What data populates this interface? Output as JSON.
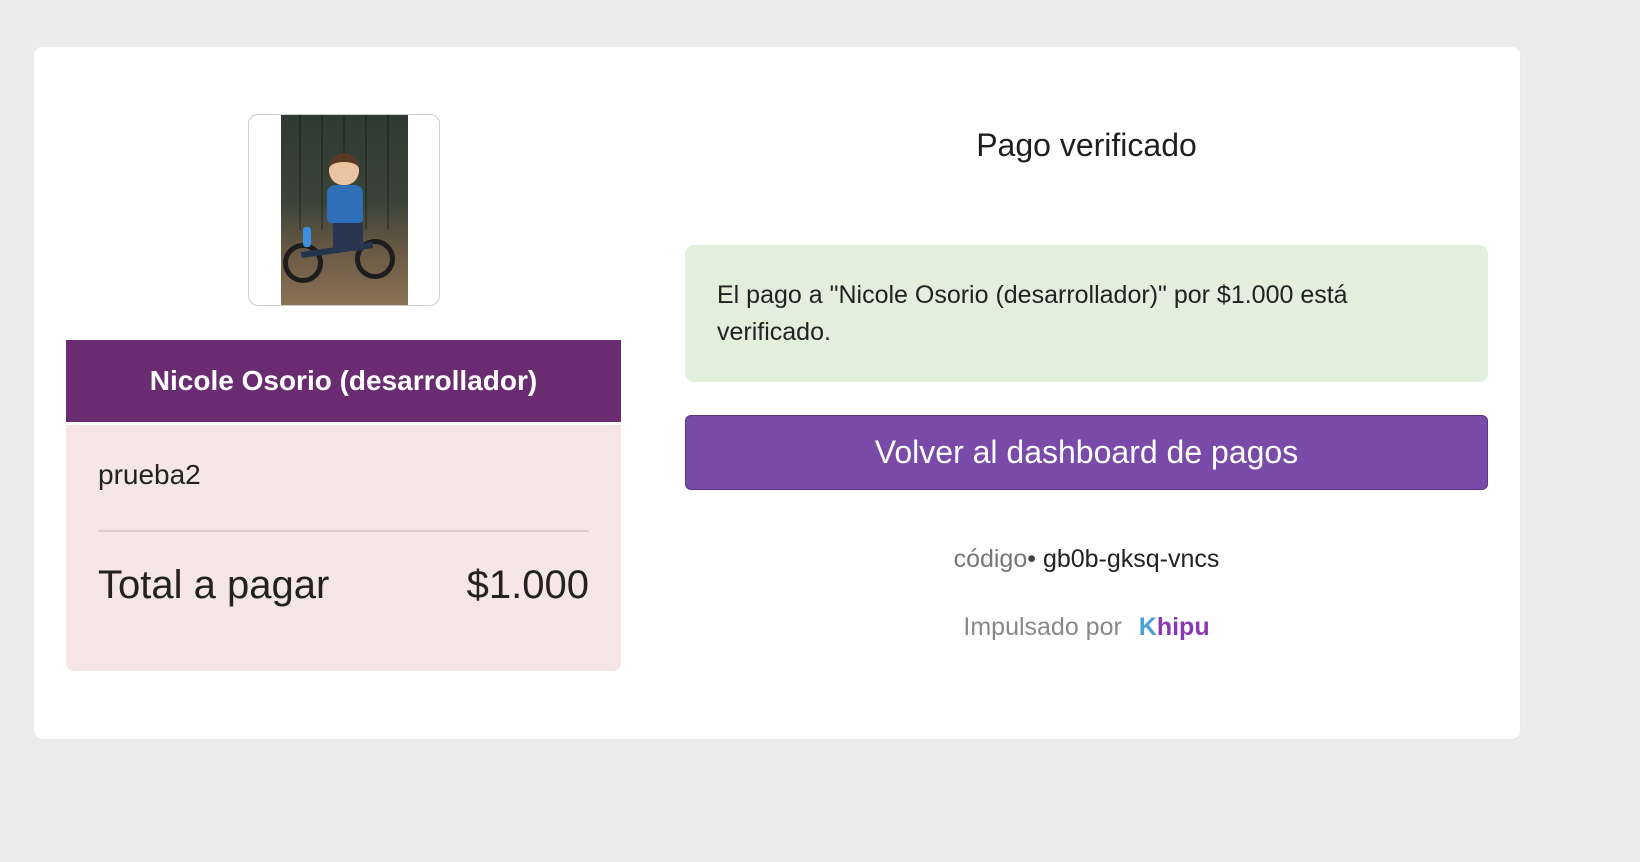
{
  "merchant": {
    "name": "Nicole Osorio (desarrollador)",
    "avatar_icon": "merchant-photo"
  },
  "summary": {
    "description": "prueba2",
    "total_label": "Total a pagar",
    "total_amount": "$1.000"
  },
  "status": {
    "title": "Pago verificado",
    "message": "El pago a \"Nicole Osorio (desarrollador)\" por $1.000 está verificado."
  },
  "actions": {
    "back_label": "Volver al dashboard de pagos"
  },
  "code": {
    "label": "código",
    "separator": "• ",
    "value": "gb0b-gksq-vncs"
  },
  "footer": {
    "powered_label": "Impulsado por",
    "brand_k": "K",
    "brand_rest": "hipu"
  },
  "colors": {
    "merchant_bar": "#6a2c71",
    "summary_bg": "#f6e6e6",
    "alert_bg": "#e2efdc",
    "button_bg": "#7a4aa8"
  }
}
